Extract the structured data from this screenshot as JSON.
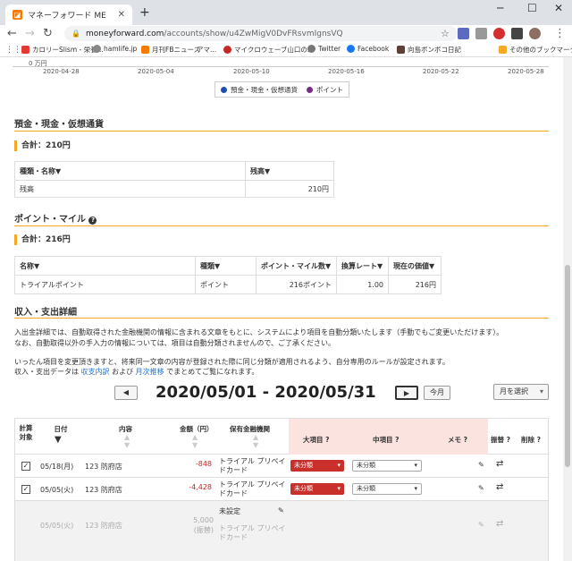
{
  "browser": {
    "tab_title": "マネーフォワード ME",
    "url_host": "moneyforward.com",
    "url_path": "/accounts/show/u4ZwMigV0DvFRsvmIgnsVQ",
    "bookmarks": [
      "カロリーSlism - 栄養...",
      "hamlife.jp",
      "月刊FBニュース",
      "アマ...",
      "マイクロウェーブ山口の...",
      "Twitter",
      "Facebook",
      "向島ボンボコ日記",
      "その他のブックマーク"
    ]
  },
  "chart_data": {
    "type": "line",
    "y_tick": "0 万円",
    "x": [
      "2020-04-28",
      "2020-05-04",
      "2020-05-10",
      "2020-05-16",
      "2020-05-22",
      "2020-05-28"
    ],
    "legend": [
      {
        "name": "預金・現金・仮想通貨",
        "color": "#1e4fb5"
      },
      {
        "name": "ポイント",
        "color": "#7b2a8a"
      }
    ]
  },
  "deposits": {
    "title": "預金・現金・仮想通貨",
    "total": "合計：210円",
    "headers": [
      "種類・名称▼",
      "残高▼"
    ],
    "rows": [
      {
        "name": "残高",
        "value": "210円"
      }
    ]
  },
  "points": {
    "title": "ポイント・マイル",
    "total": "合計：216円",
    "headers": [
      "名称▼",
      "種類▼",
      "ポイント・マイル数▼",
      "換算レート▼",
      "現在の価値▼"
    ],
    "rows": [
      {
        "name": "トライアルポイント",
        "type": "ポイント",
        "count": "216ポイント",
        "rate": "1.00",
        "value": "216円"
      }
    ]
  },
  "income": {
    "title": "収入・支出詳細",
    "para1": "入出金詳細では、自動取得された金融機関の情報に含まれる文章をもとに、システムにより項目を自動分類いたします（手動でもご変更いただけます）。",
    "para2": "なお、自動取得以外の手入力の情報については、項目は自動分類されませんので、ご了承ください。",
    "para3": "いったん項目を変更頂きますと、将来同一文章の内容が登録された際に同じ分類が適用されるよう、自分専用のルールが設定されます。",
    "para4_a": "収入・支出データは",
    "para4_link1": "収支内訳",
    "para4_b": "および",
    "para4_link2": "月次推移",
    "para4_c": "でまとめてご覧になれます。",
    "prev": "◀",
    "next": "▶",
    "date_range": "2020/05/01 - 2020/05/31",
    "this_month": "今月",
    "month_select": "月を選択",
    "headers": {
      "calc": "計算対象",
      "date": "日付",
      "content": "内容",
      "amount": "金額（円）",
      "institution": "保有金融機関",
      "major": "大項目",
      "middle": "中項目",
      "memo": "メモ",
      "transfer": "振替",
      "delete": "削除"
    },
    "rows": [
      {
        "date": "05/18(月)",
        "content": "123 防府店",
        "amount": "-848",
        "inst1": "トライアル プリペイ",
        "inst2": "ドカード",
        "major": "未分類",
        "middle": "未分類"
      },
      {
        "date": "05/05(火)",
        "content": "123 防府店",
        "amount": "-4,428",
        "inst1": "トライアル プリペイ",
        "inst2": "ドカード",
        "major": "未分類",
        "middle": "未分類"
      },
      {
        "date": "05/05(火)",
        "content": "123 防府店",
        "amount": "5,000",
        "amount_note": "(振替)",
        "inst_top": "未設定",
        "inst1": "トライアル プリペイ",
        "inst2": "ドカード"
      }
    ]
  }
}
